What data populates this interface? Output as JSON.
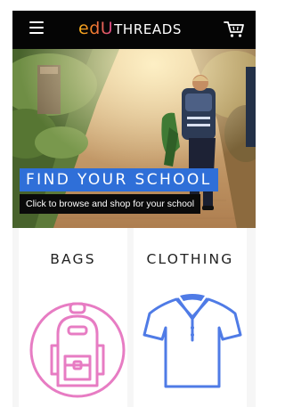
{
  "header": {
    "logo_edu": "edU",
    "logo_threads": "THREADS",
    "menu_icon": "hamburger-menu-icon",
    "cart_icon": "shopping-cart-icon"
  },
  "hero": {
    "title": "FIND YOUR SCHOOL",
    "subtitle": "Click to browse and shop for your school",
    "title_bg_color": "#2f6fd8",
    "subtitle_bg_color": "#0a0a0a"
  },
  "categories": [
    {
      "label": "BAGS",
      "icon": "backpack-icon",
      "icon_color": "#e77cc3"
    },
    {
      "label": "CLOTHING",
      "icon": "polo-shirt-icon",
      "icon_color": "#4f7be6"
    }
  ],
  "colors": {
    "header_bg": "#050505",
    "logo_gradient": [
      "#f6b21a",
      "#f27a2c",
      "#d6448c"
    ]
  }
}
